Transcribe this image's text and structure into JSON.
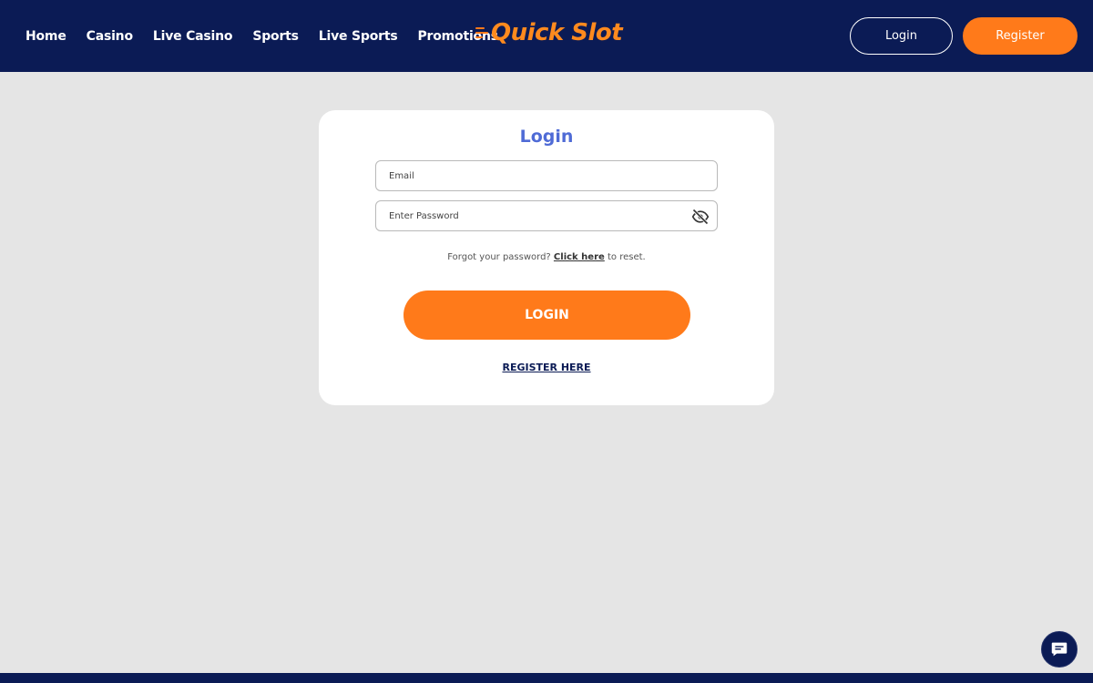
{
  "header": {
    "nav": [
      {
        "label": "Home"
      },
      {
        "label": "Casino"
      },
      {
        "label": "Live Casino"
      },
      {
        "label": "Sports"
      },
      {
        "label": "Live Sports"
      },
      {
        "label": "Promotions"
      }
    ],
    "logo_text": "Quick Slot",
    "login_label": "Login",
    "register_label": "Register"
  },
  "login_card": {
    "title": "Login",
    "email_placeholder": "Email",
    "password_placeholder": "Enter Password",
    "forgot_prefix": "Forgot your password?",
    "forgot_link": "Click here",
    "forgot_suffix": "to reset.",
    "login_button": "LOGIN",
    "register_link": "REGISTER HERE"
  },
  "icons": {
    "password_toggle": "eye-slash-icon",
    "chat": "chat-icon"
  },
  "colors": {
    "header_bg": "#0b1b55",
    "accent": "#ff7a1a",
    "title": "#4f6bd6",
    "page_bg": "#e5e5e5"
  }
}
